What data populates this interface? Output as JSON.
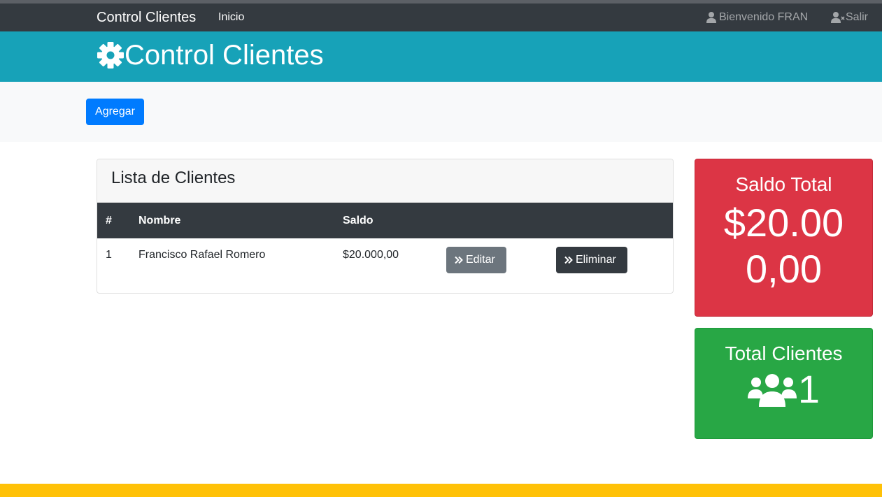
{
  "navbar": {
    "brand": "Control Clientes",
    "inicio": "Inicio",
    "welcome": "Bienvenido FRAN",
    "logout": "Salir",
    "user_icon": "user-icon",
    "logout_icon": "user-times-icon"
  },
  "hero": {
    "icon": "gear-icon",
    "title": "Control Clientes"
  },
  "actions": {
    "add_label": "Agregar"
  },
  "clients": {
    "header": "Lista de Clientes",
    "columns": [
      "#",
      "Nombre",
      "Saldo"
    ],
    "rows": [
      {
        "index": "1",
        "name": "Francisco Rafael Romero",
        "balance": "$20.000,00",
        "edit_label": "Editar",
        "delete_label": "Eliminar"
      }
    ]
  },
  "stats": {
    "balance_title": "Saldo Total",
    "balance_value": "$20.000,00",
    "clients_title": "Total Clientes",
    "clients_icon": "users-icon",
    "clients_value": "1"
  },
  "colors": {
    "navbar": "#343a40",
    "hero": "#17a2b8",
    "primary": "#007bff",
    "danger": "#dc3545",
    "success": "#28a745",
    "warning": "#ffc107",
    "secondary": "#6c757d"
  }
}
